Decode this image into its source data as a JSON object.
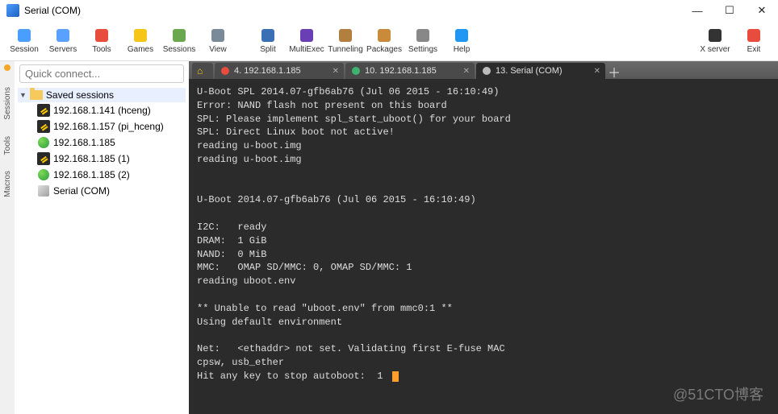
{
  "window": {
    "title": "Serial (COM)"
  },
  "wincontrols": {
    "min": "—",
    "max": "☐",
    "close": "✕"
  },
  "toolbar": [
    {
      "label": "Session",
      "icon": "session-icon",
      "color": "#4a9eff"
    },
    {
      "label": "Servers",
      "icon": "servers-icon",
      "color": "#5aa0ff"
    },
    {
      "label": "Tools",
      "icon": "tools-icon",
      "color": "#e74c3c"
    },
    {
      "label": "Games",
      "icon": "games-icon",
      "color": "#f5c518"
    },
    {
      "label": "Sessions",
      "icon": "sessions-icon",
      "color": "#6aa84f"
    },
    {
      "label": "View",
      "icon": "view-icon",
      "color": "#7b8a99"
    },
    {
      "label": "Split",
      "icon": "split-icon",
      "color": "#3b6fb6"
    },
    {
      "label": "MultiExec",
      "icon": "multiexec-icon",
      "color": "#6a3fb5"
    },
    {
      "label": "Tunneling",
      "icon": "tunneling-icon",
      "color": "#b37f3f"
    },
    {
      "label": "Packages",
      "icon": "packages-icon",
      "color": "#c98b3a"
    },
    {
      "label": "Settings",
      "icon": "settings-icon",
      "color": "#888"
    },
    {
      "label": "Help",
      "icon": "help-icon",
      "color": "#2196f3"
    }
  ],
  "toolbar_right": [
    {
      "label": "X server",
      "icon": "xserver-icon",
      "color": "#333"
    },
    {
      "label": "Exit",
      "icon": "exit-icon",
      "color": "#e74c3c"
    }
  ],
  "sidestrip": [
    "Sessions",
    "Tools",
    "Macros"
  ],
  "quick_connect": {
    "placeholder": "Quick connect..."
  },
  "tree": {
    "root": "Saved sessions",
    "nodes": [
      {
        "label": "192.168.1.141 (hceng)",
        "type": "ssh"
      },
      {
        "label": "192.168.1.157 (pi_hceng)",
        "type": "ssh"
      },
      {
        "label": "192.168.1.185",
        "type": "globe"
      },
      {
        "label": "192.168.1.185 (1)",
        "type": "ssh"
      },
      {
        "label": "192.168.1.185 (2)",
        "type": "globe"
      },
      {
        "label": "Serial (COM)",
        "type": "serial"
      }
    ]
  },
  "tabs": [
    {
      "label": "4. 192.168.1.185",
      "dot": "#e74c3c",
      "active": false
    },
    {
      "label": "10. 192.168.1.185",
      "dot": "#3cb371",
      "active": false
    },
    {
      "label": "13. Serial (COM)",
      "dot": "#bbb",
      "active": true
    }
  ],
  "terminal": {
    "lines": [
      "U-Boot SPL 2014.07-gfb6ab76 (Jul 06 2015 - 16:10:49)",
      "Error: NAND flash not present on this board",
      "SPL: Please implement spl_start_uboot() for your board",
      "SPL: Direct Linux boot not active!",
      "reading u-boot.img",
      "reading u-boot.img",
      "",
      "",
      "U-Boot 2014.07-gfb6ab76 (Jul 06 2015 - 16:10:49)",
      "",
      "I2C:   ready",
      "DRAM:  1 GiB",
      "NAND:  0 MiB",
      "MMC:   OMAP SD/MMC: 0, OMAP SD/MMC: 1",
      "reading uboot.env",
      "",
      "** Unable to read \"uboot.env\" from mmc0:1 **",
      "Using default environment",
      "",
      "Net:   <ethaddr> not set. Validating first E-fuse MAC",
      "cpsw, usb_ether",
      "Hit any key to stop autoboot:  1 "
    ]
  },
  "watermark": "@51CTO博客"
}
